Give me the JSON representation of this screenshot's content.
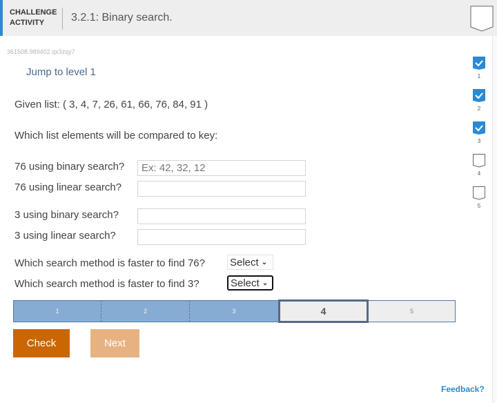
{
  "header": {
    "kind_line1": "CHALLENGE",
    "kind_line2": "ACTIVITY",
    "title": "3.2.1: Binary search.",
    "badge_icon": "completion-shield-icon"
  },
  "activity_id": "361508.989402.qx3zqy7",
  "jump_link": "Jump to level 1",
  "levels": [
    {
      "label": "1",
      "state": "complete"
    },
    {
      "label": "2",
      "state": "complete"
    },
    {
      "label": "3",
      "state": "complete"
    },
    {
      "label": "4",
      "state": "incomplete"
    },
    {
      "label": "5",
      "state": "incomplete"
    }
  ],
  "question": {
    "given_list": "Given list: ( 3, 4, 7, 26, 61, 66, 76, 84, 91 )",
    "prompt": "Which list elements will be compared to key:",
    "fields": [
      {
        "label": "76 using binary search?",
        "value": "",
        "placeholder": "Ex: 42, 32, 12"
      },
      {
        "label": "76 using linear search?",
        "value": "",
        "placeholder": ""
      },
      {
        "label": "3 using binary search?",
        "value": "",
        "placeholder": ""
      },
      {
        "label": "3 using linear search?",
        "value": "",
        "placeholder": ""
      }
    ],
    "selects": [
      {
        "label": "Which search method is faster to find 76?",
        "selected": "Select"
      },
      {
        "label": "Which search method is faster to find 3?",
        "selected": "Select"
      }
    ]
  },
  "progress": {
    "segments": [
      "1",
      "2",
      "3",
      "4",
      "5"
    ],
    "current": "4",
    "completed_count": 3
  },
  "buttons": {
    "check": "Check",
    "next": "Next"
  },
  "feedback_link": "Feedback?",
  "colors": {
    "accent": "#2b8ad3",
    "check_button": "#cc6600",
    "next_button_disabled": "#e7b282",
    "progress_done": "#86acd3",
    "progress_border": "#56698a"
  }
}
